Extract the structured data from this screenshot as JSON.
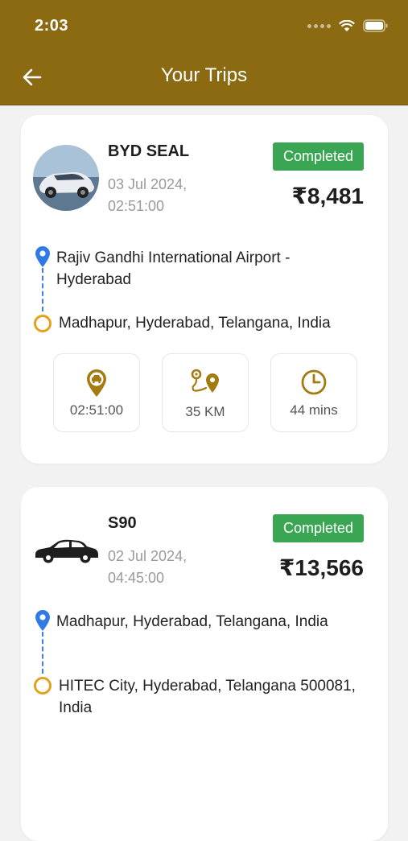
{
  "status_bar": {
    "time": "2:03"
  },
  "header": {
    "title": "Your Trips",
    "back_icon": "arrow-left-icon"
  },
  "colors": {
    "header": "#8b6a12",
    "completed": "#3aa653",
    "pickup_pin": "#2e7be6",
    "dropoff_ring": "#e2a21b",
    "stat_icon": "#a37b10"
  },
  "trips": [
    {
      "car_name": "BYD SEAL",
      "date": "03 Jul 2024,",
      "time": "02:51:00",
      "status": "Completed",
      "fare": "₹8,481",
      "pickup": "Rajiv Gandhi International Airport - Hyderabad",
      "dropoff": "Madhapur, Hyderabad, Telangana, India",
      "stats": {
        "time": "02:51:00",
        "distance": "35 KM",
        "duration": "44 mins"
      }
    },
    {
      "car_name": "S90",
      "date": "02 Jul 2024,",
      "time": "04:45:00",
      "status": "Completed",
      "fare": "₹13,566",
      "pickup": "Madhapur, Hyderabad, Telangana, India",
      "dropoff": "HITEC City, Hyderabad, Telangana 500081, India"
    }
  ]
}
